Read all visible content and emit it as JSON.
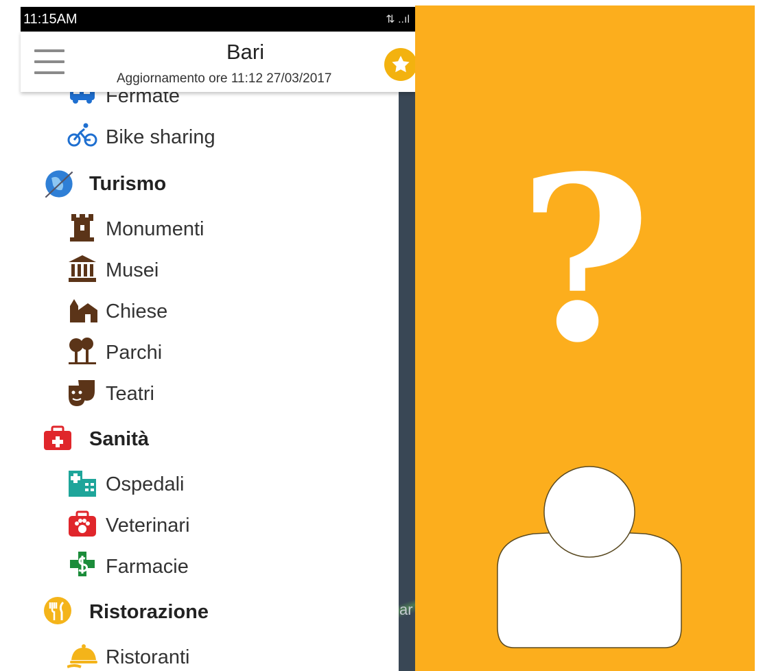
{
  "status_bar": {
    "time": "11:15AM",
    "signal": "⇅ ..ıl"
  },
  "header": {
    "title": "Bari",
    "subtitle": "Aggiornamento ore 11:12 27/03/2017"
  },
  "map": {
    "partial_text": "ar"
  },
  "drawer": {
    "items": [
      {
        "label": "Fermate",
        "type": "sub",
        "icon": "bus-icon"
      },
      {
        "label": "Bike sharing",
        "type": "sub",
        "icon": "bicycle-icon"
      },
      {
        "label": "Turismo",
        "type": "category",
        "icon": "globe-plane-icon"
      },
      {
        "label": "Monumenti",
        "type": "sub",
        "icon": "tower-icon"
      },
      {
        "label": "Musei",
        "type": "sub",
        "icon": "museum-icon"
      },
      {
        "label": "Chiese",
        "type": "sub",
        "icon": "church-icon"
      },
      {
        "label": "Parchi",
        "type": "sub",
        "icon": "trees-icon"
      },
      {
        "label": "Teatri",
        "type": "sub",
        "icon": "theater-masks-icon"
      },
      {
        "label": "Sanità",
        "type": "category",
        "icon": "medical-bag-icon"
      },
      {
        "label": "Ospedali",
        "type": "sub",
        "icon": "hospital-icon"
      },
      {
        "label": "Veterinari",
        "type": "sub",
        "icon": "vet-paw-icon"
      },
      {
        "label": "Farmacie",
        "type": "sub",
        "icon": "pharmacy-icon"
      },
      {
        "label": "Ristorazione",
        "type": "category",
        "icon": "fork-knife-icon"
      },
      {
        "label": "Ristoranti",
        "type": "sub",
        "icon": "cloche-icon"
      }
    ]
  },
  "placeholder": {
    "symbol": "?",
    "icon": "user-silhouette-icon"
  },
  "colors": {
    "accent_orange": "#fcae1d",
    "star_yellow": "#f3b20f",
    "bike_blue": "#1e6fd0",
    "monument_brown": "#5b3418",
    "medical_red": "#e0262b",
    "hospital_teal": "#1ea59a",
    "pharmacy_green": "#1b8c3a",
    "food_yellow": "#f4b41a"
  }
}
